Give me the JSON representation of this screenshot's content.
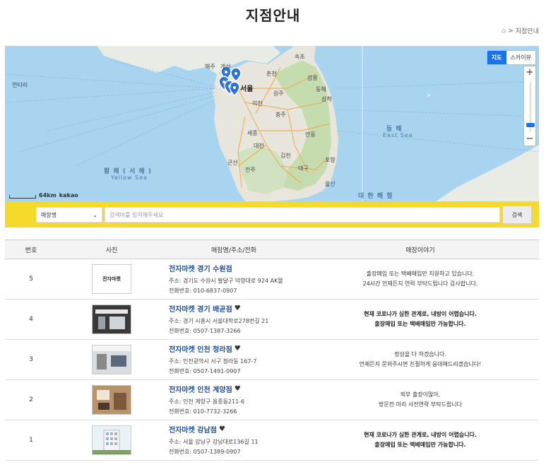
{
  "page": {
    "title": "지점안내"
  },
  "breadcrumb": {
    "current": "지점안내"
  },
  "map": {
    "type_buttons": [
      "지도",
      "스카이뷰"
    ],
    "scale": "64km",
    "logo": "kakao",
    "labels": {
      "seoul": "서울",
      "gaeseong": "개성",
      "haeju": "해주",
      "sokcho": "속초",
      "gangneung": "강릉",
      "chuncheon": "춘천",
      "wonju": "원주",
      "icheon": "이천",
      "chungju": "충주",
      "sejong": "세종",
      "daejeon": "대전",
      "gimcheon": "김천",
      "daegu": "대구",
      "pohang": "포항",
      "ulsan": "울산",
      "andong": "안동",
      "gunsan": "군산",
      "jeonju": "전주",
      "donghae": "동해",
      "samcheok": "삼척",
      "yellow_sea_kr": "황 해 ( 서 해 )",
      "yellow_sea_en": "Yellow Sea",
      "east_sea_kr": "동 해",
      "east_sea_en": "East Sea",
      "korea_strait": "대 한 해 협",
      "yeontiri": "연티리"
    }
  },
  "search": {
    "select_value": "매장명",
    "placeholder": "검색어를 입력해주세요",
    "button": "검색"
  },
  "table": {
    "headers": [
      "번호",
      "사진",
      "매장명/주소/전화",
      "매장이야기"
    ],
    "rows": [
      {
        "no": "5",
        "name": "전자마켓 경기 수원점",
        "heart": false,
        "address": "주소: 경기도 수원시 팔달구 덕영대로 924 AK몰",
        "phone": "전화번호: 010-6837-0907",
        "story": [
          "출장매입 또는 택배매입만 지원하고 있습니다.",
          "24시간 언제든지 연락 부탁드립니다 감사합니다."
        ],
        "bold": false,
        "thumb": "logo"
      },
      {
        "no": "4",
        "name": "전자마켓 경기 배곧점",
        "heart": true,
        "address": "주소: 경기 시흥시 서울대학로278번길 21",
        "phone": "전화번호: 0507-1387-3266",
        "story": [
          "현재 코로나가 심한 관계로, 내방이 어렵습니다.",
          "출장매입 또는 택배매입만 가능합니다."
        ],
        "bold": true,
        "thumb": "store-dark"
      },
      {
        "no": "3",
        "name": "전자마켓 인천 청라점",
        "heart": true,
        "address": "주소: 인천광역시 서구 청라동 167-7",
        "phone": "전화번호: 0507-1491-0907",
        "story": [
          "정성을 다 하겠습니다.",
          "언제든지 문의주시면 친절하게 응대해드리겠습니다!"
        ],
        "bold": false,
        "thumb": "store-light"
      },
      {
        "no": "2",
        "name": "전자마켓 인천 계양점",
        "heart": true,
        "address": "주소: 인천 계양구 용종동211-6",
        "phone": "전화번호: 010-7732-3266",
        "story": [
          "외부 출장이많아,",
          "방문전 미리 사전연락 부탁드립니다"
        ],
        "bold": false,
        "thumb": "store-warm"
      },
      {
        "no": "1",
        "name": "전자마켓 강남점",
        "heart": true,
        "address": "주소: 서울 강남구 강남대로136길 11",
        "phone": "전화번호: 0507-1389-0907",
        "story": [
          "현재 코로나가 심한 관계로, 내방이 어렵습니다.",
          "출장매입 또는 택배매입만 가능합니다."
        ],
        "bold": true,
        "thumb": "building"
      }
    ]
  },
  "logo_text": "전자마켓",
  "colors": {
    "accent": "#f5da2c",
    "link": "#1f4e9a",
    "map_button": "#1a73e8",
    "marker": "#2f74d8"
  }
}
